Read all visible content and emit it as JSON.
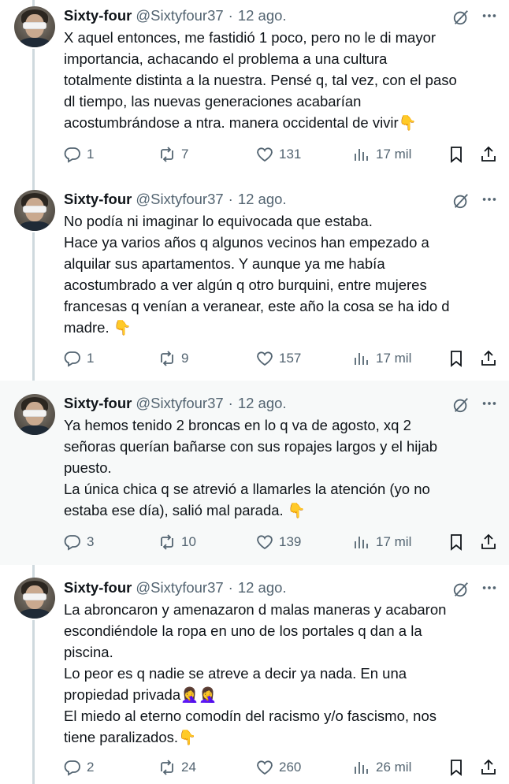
{
  "tweets": [
    {
      "name": "Sixty-four",
      "handle": "@Sixtyfour37",
      "dot": "·",
      "date": "12 ago.",
      "text": "X aquel entonces, me fastidió 1 poco, pero no le di mayor\nimportancia, achacando el problema a una cultura\ntotalmente distinta a la nuestra. Pensé q, tal vez, con el paso\ndl tiempo, las nuevas generaciones acabarían\nacostumbrándose a ntra. manera occidental de vivir👇",
      "replies": "1",
      "reposts": "7",
      "likes": "131",
      "views": "17 mil"
    },
    {
      "name": "Sixty-four",
      "handle": "@Sixtyfour37",
      "dot": "·",
      "date": "12 ago.",
      "text": "No podía ni imaginar lo equivocada que estaba.\nHace ya varios años q algunos vecinos han empezado a\nalquilar sus apartamentos. Y aunque ya me había\nacostumbrado a ver algún q otro burquini, entre mujeres\nfrancesas q venían a veranear, este año la cosa se ha ido d\nmadre. 👇",
      "replies": "1",
      "reposts": "9",
      "likes": "157",
      "views": "17 mil"
    },
    {
      "name": "Sixty-four",
      "handle": "@Sixtyfour37",
      "dot": "·",
      "date": "12 ago.",
      "text": "Ya hemos tenido 2 broncas en lo q va de agosto, xq 2\nseñoras querían bañarse con sus ropajes largos y el hijab\npuesto.\nLa única chica q se atrevió a llamarles la atención (yo no\nestaba ese día), salió mal parada. 👇",
      "replies": "3",
      "reposts": "10",
      "likes": "139",
      "views": "17 mil"
    },
    {
      "name": "Sixty-four",
      "handle": "@Sixtyfour37",
      "dot": "·",
      "date": "12 ago.",
      "text": "La abroncaron y amenazaron d malas maneras y acabaron\nescondiéndole la ropa en uno de los portales q dan a la\npiscina.\nLo peor es q nadie se atreve a decir ya nada. En una\npropiedad privada🤦‍♀️🤦‍♀️\nEl miedo al eterno comodín del racismo y/o fascismo, nos\ntiene paralizados.👇",
      "replies": "2",
      "reposts": "24",
      "likes": "260",
      "views": "26 mil"
    }
  ],
  "icons": {
    "reply": "reply-icon",
    "repost": "repost-icon",
    "like": "heart-icon",
    "views": "views-icon",
    "bookmark": "bookmark-icon",
    "share": "share-icon",
    "grok": "grok-icon",
    "more": "more-icon"
  },
  "colors": {
    "text": "#0f1419",
    "secondary": "#536471",
    "thread_line": "#cfd9de",
    "highlight_bg": "#f7f9f9"
  }
}
